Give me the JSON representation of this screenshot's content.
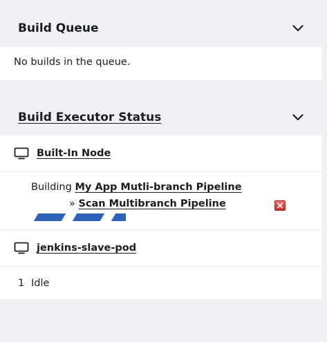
{
  "build_queue": {
    "title": "Build Queue",
    "empty_message": "No builds in the queue."
  },
  "executor_status": {
    "title": "Build Executor Status",
    "nodes": [
      {
        "name": "Built-In Node",
        "icon": "computer-icon",
        "build": {
          "prefix": "Building",
          "job": "My App Mutli-branch Pipeline",
          "separator": "»",
          "step": "Scan Multibranch Pipeline",
          "stop_icon": "stop-icon"
        }
      },
      {
        "name": "jenkins-slave-pod",
        "icon": "computer-icon",
        "executor": {
          "number": "1",
          "status": "Idle"
        }
      }
    ]
  },
  "colors": {
    "progress": "#2e62b8",
    "stop": "#d42a2a",
    "header_bg": "#f1f1f4"
  }
}
